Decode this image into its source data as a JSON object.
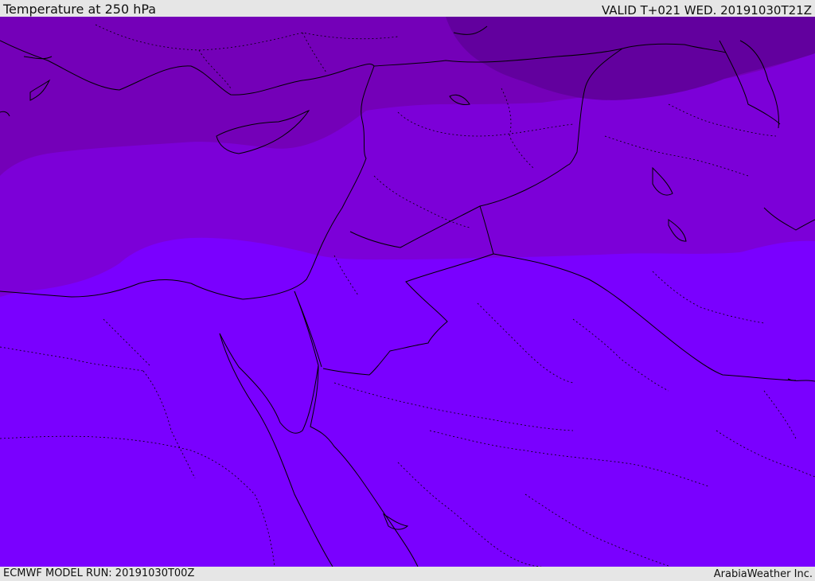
{
  "header": {
    "title": "Temperature at 250 hPa",
    "valid_time": "VALID T+021 WED. 20191030T21Z"
  },
  "footer": {
    "model_run": "ECMWF MODEL RUN: 20191030T00Z",
    "credit": "ArabiaWeather Inc."
  },
  "map": {
    "layer": "temperature-250hPa",
    "bands": [
      {
        "name": "coldest-band",
        "color": "#62009e"
      },
      {
        "name": "cold-band",
        "color": "#7400b8"
      },
      {
        "name": "mid-band",
        "color": "#7c00d8"
      },
      {
        "name": "warm-band",
        "color": "#7a00ff"
      }
    ],
    "boundary_color": "#000000"
  }
}
